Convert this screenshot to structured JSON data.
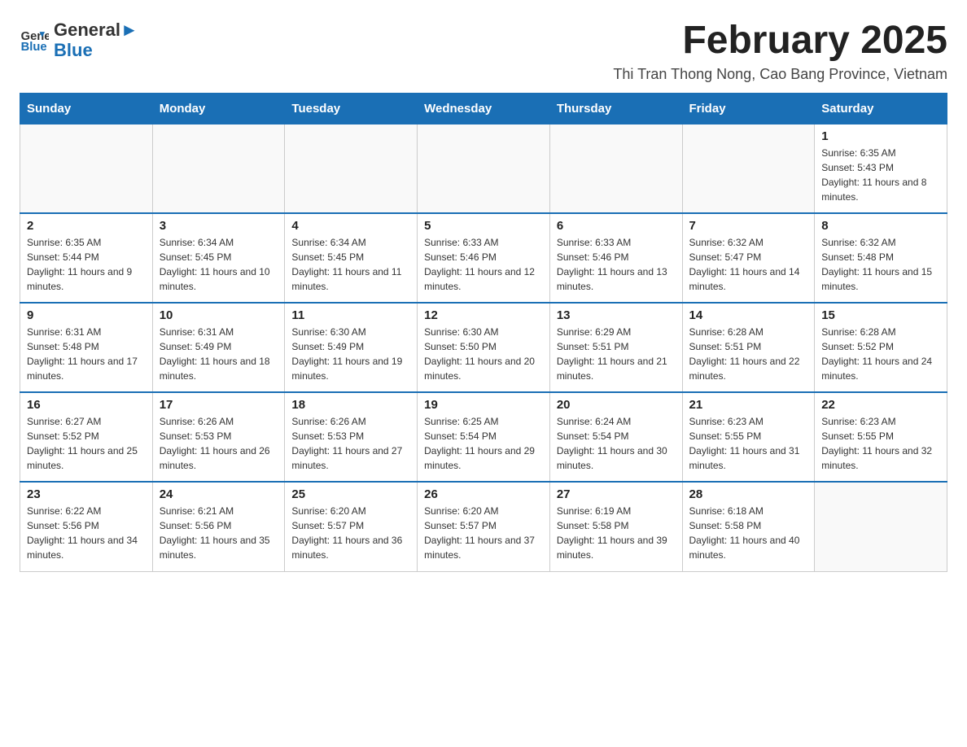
{
  "header": {
    "logo_text_general": "General",
    "logo_text_blue": "Blue",
    "main_title": "February 2025",
    "subtitle": "Thi Tran Thong Nong, Cao Bang Province, Vietnam"
  },
  "days_of_week": [
    "Sunday",
    "Monday",
    "Tuesday",
    "Wednesday",
    "Thursday",
    "Friday",
    "Saturday"
  ],
  "weeks": [
    {
      "days": [
        {
          "number": "",
          "info": ""
        },
        {
          "number": "",
          "info": ""
        },
        {
          "number": "",
          "info": ""
        },
        {
          "number": "",
          "info": ""
        },
        {
          "number": "",
          "info": ""
        },
        {
          "number": "",
          "info": ""
        },
        {
          "number": "1",
          "info": "Sunrise: 6:35 AM\nSunset: 5:43 PM\nDaylight: 11 hours and 8 minutes."
        }
      ]
    },
    {
      "days": [
        {
          "number": "2",
          "info": "Sunrise: 6:35 AM\nSunset: 5:44 PM\nDaylight: 11 hours and 9 minutes."
        },
        {
          "number": "3",
          "info": "Sunrise: 6:34 AM\nSunset: 5:45 PM\nDaylight: 11 hours and 10 minutes."
        },
        {
          "number": "4",
          "info": "Sunrise: 6:34 AM\nSunset: 5:45 PM\nDaylight: 11 hours and 11 minutes."
        },
        {
          "number": "5",
          "info": "Sunrise: 6:33 AM\nSunset: 5:46 PM\nDaylight: 11 hours and 12 minutes."
        },
        {
          "number": "6",
          "info": "Sunrise: 6:33 AM\nSunset: 5:46 PM\nDaylight: 11 hours and 13 minutes."
        },
        {
          "number": "7",
          "info": "Sunrise: 6:32 AM\nSunset: 5:47 PM\nDaylight: 11 hours and 14 minutes."
        },
        {
          "number": "8",
          "info": "Sunrise: 6:32 AM\nSunset: 5:48 PM\nDaylight: 11 hours and 15 minutes."
        }
      ]
    },
    {
      "days": [
        {
          "number": "9",
          "info": "Sunrise: 6:31 AM\nSunset: 5:48 PM\nDaylight: 11 hours and 17 minutes."
        },
        {
          "number": "10",
          "info": "Sunrise: 6:31 AM\nSunset: 5:49 PM\nDaylight: 11 hours and 18 minutes."
        },
        {
          "number": "11",
          "info": "Sunrise: 6:30 AM\nSunset: 5:49 PM\nDaylight: 11 hours and 19 minutes."
        },
        {
          "number": "12",
          "info": "Sunrise: 6:30 AM\nSunset: 5:50 PM\nDaylight: 11 hours and 20 minutes."
        },
        {
          "number": "13",
          "info": "Sunrise: 6:29 AM\nSunset: 5:51 PM\nDaylight: 11 hours and 21 minutes."
        },
        {
          "number": "14",
          "info": "Sunrise: 6:28 AM\nSunset: 5:51 PM\nDaylight: 11 hours and 22 minutes."
        },
        {
          "number": "15",
          "info": "Sunrise: 6:28 AM\nSunset: 5:52 PM\nDaylight: 11 hours and 24 minutes."
        }
      ]
    },
    {
      "days": [
        {
          "number": "16",
          "info": "Sunrise: 6:27 AM\nSunset: 5:52 PM\nDaylight: 11 hours and 25 minutes."
        },
        {
          "number": "17",
          "info": "Sunrise: 6:26 AM\nSunset: 5:53 PM\nDaylight: 11 hours and 26 minutes."
        },
        {
          "number": "18",
          "info": "Sunrise: 6:26 AM\nSunset: 5:53 PM\nDaylight: 11 hours and 27 minutes."
        },
        {
          "number": "19",
          "info": "Sunrise: 6:25 AM\nSunset: 5:54 PM\nDaylight: 11 hours and 29 minutes."
        },
        {
          "number": "20",
          "info": "Sunrise: 6:24 AM\nSunset: 5:54 PM\nDaylight: 11 hours and 30 minutes."
        },
        {
          "number": "21",
          "info": "Sunrise: 6:23 AM\nSunset: 5:55 PM\nDaylight: 11 hours and 31 minutes."
        },
        {
          "number": "22",
          "info": "Sunrise: 6:23 AM\nSunset: 5:55 PM\nDaylight: 11 hours and 32 minutes."
        }
      ]
    },
    {
      "days": [
        {
          "number": "23",
          "info": "Sunrise: 6:22 AM\nSunset: 5:56 PM\nDaylight: 11 hours and 34 minutes."
        },
        {
          "number": "24",
          "info": "Sunrise: 6:21 AM\nSunset: 5:56 PM\nDaylight: 11 hours and 35 minutes."
        },
        {
          "number": "25",
          "info": "Sunrise: 6:20 AM\nSunset: 5:57 PM\nDaylight: 11 hours and 36 minutes."
        },
        {
          "number": "26",
          "info": "Sunrise: 6:20 AM\nSunset: 5:57 PM\nDaylight: 11 hours and 37 minutes."
        },
        {
          "number": "27",
          "info": "Sunrise: 6:19 AM\nSunset: 5:58 PM\nDaylight: 11 hours and 39 minutes."
        },
        {
          "number": "28",
          "info": "Sunrise: 6:18 AM\nSunset: 5:58 PM\nDaylight: 11 hours and 40 minutes."
        },
        {
          "number": "",
          "info": ""
        }
      ]
    }
  ]
}
